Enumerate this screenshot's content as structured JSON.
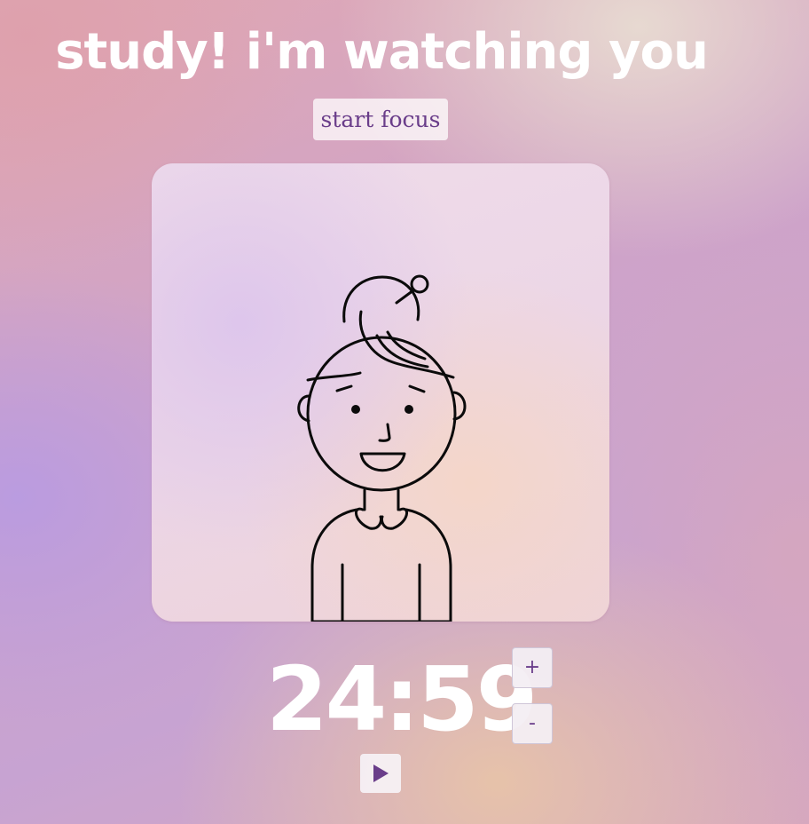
{
  "header": {
    "title": "study! i'm watching you"
  },
  "controls": {
    "start_focus_label": "start focus",
    "increase_label": "+",
    "decrease_label": "-",
    "play_icon": "play-icon"
  },
  "timer": {
    "display": "24:59"
  },
  "illustration": {
    "subject": "smiling-girl-with-hair-bun"
  },
  "colors": {
    "accent": "#6a3d8a",
    "title_text": "#ffffff",
    "button_bg": "#f3eef3"
  }
}
